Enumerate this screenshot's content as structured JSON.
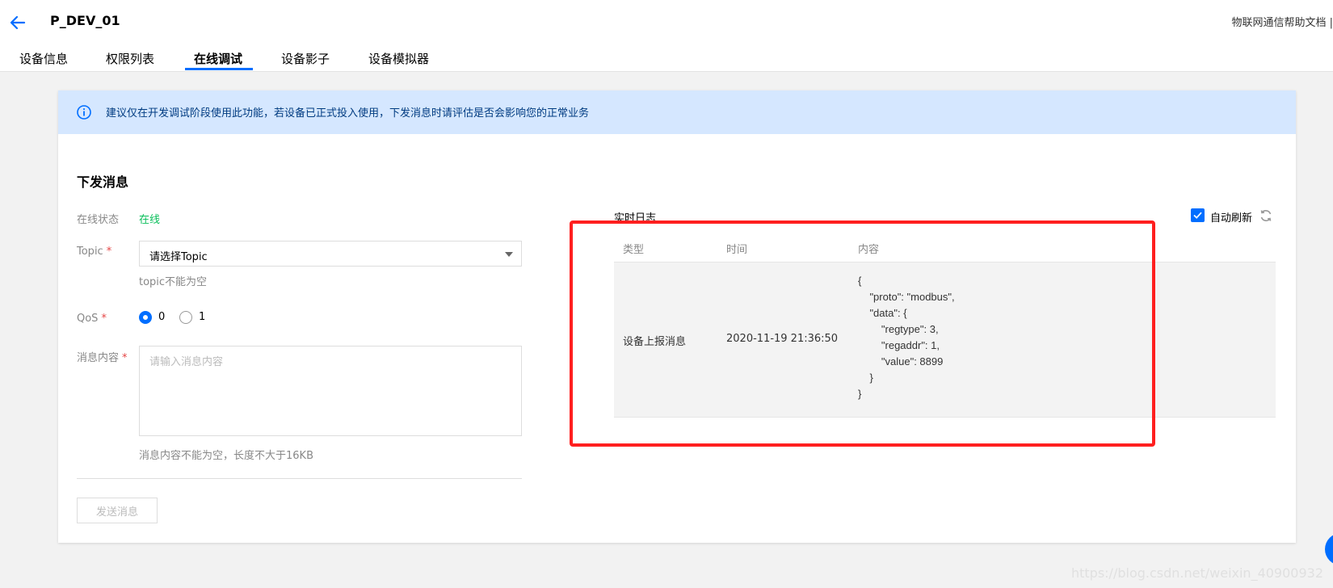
{
  "header": {
    "device_name": "P_DEV_01",
    "help_link": "物联网通信帮助文档 |"
  },
  "tabs": [
    {
      "label": "设备信息"
    },
    {
      "label": "权限列表"
    },
    {
      "label": "在线调试"
    },
    {
      "label": "设备影子"
    },
    {
      "label": "设备模拟器"
    }
  ],
  "active_tab": "在线调试",
  "notice": {
    "text": "建议仅在开发调试阶段使用此功能，若设备已正式投入使用，下发消息时请评估是否会影响您的正常业务"
  },
  "form": {
    "section_title": "下发消息",
    "status_label": "在线状态",
    "status_value": "在线",
    "topic_label": "Topic",
    "topic_placeholder": "请选择Topic",
    "topic_hint": "topic不能为空",
    "qos_label": "QoS",
    "qos_options": [
      "0",
      "1"
    ],
    "qos_selected": "0",
    "content_label": "消息内容",
    "content_placeholder": "请输入消息内容",
    "content_hint": "消息内容不能为空，长度不大于16KB",
    "required_mark": "*",
    "send_button": "发送消息"
  },
  "log": {
    "title": "实时日志",
    "auto_refresh_label": "自动刷新",
    "auto_refresh_checked": true,
    "columns": [
      "类型",
      "时间",
      "内容"
    ],
    "rows": [
      {
        "type": "设备上报消息",
        "time": "2020-11-19 21:36:50",
        "content": "{\n    \"proto\": \"modbus\",\n    \"data\": {\n        \"regtype\": 3,\n        \"regaddr\": 1,\n        \"value\": 8899\n    }\n}"
      }
    ]
  },
  "watermark": "https://blog.csdn.net/weixin_40900932",
  "colors": {
    "accent": "#006eff",
    "online": "#0abf5b",
    "notice_bg": "#d5e7ff",
    "highlight": "#ff1f1f"
  }
}
